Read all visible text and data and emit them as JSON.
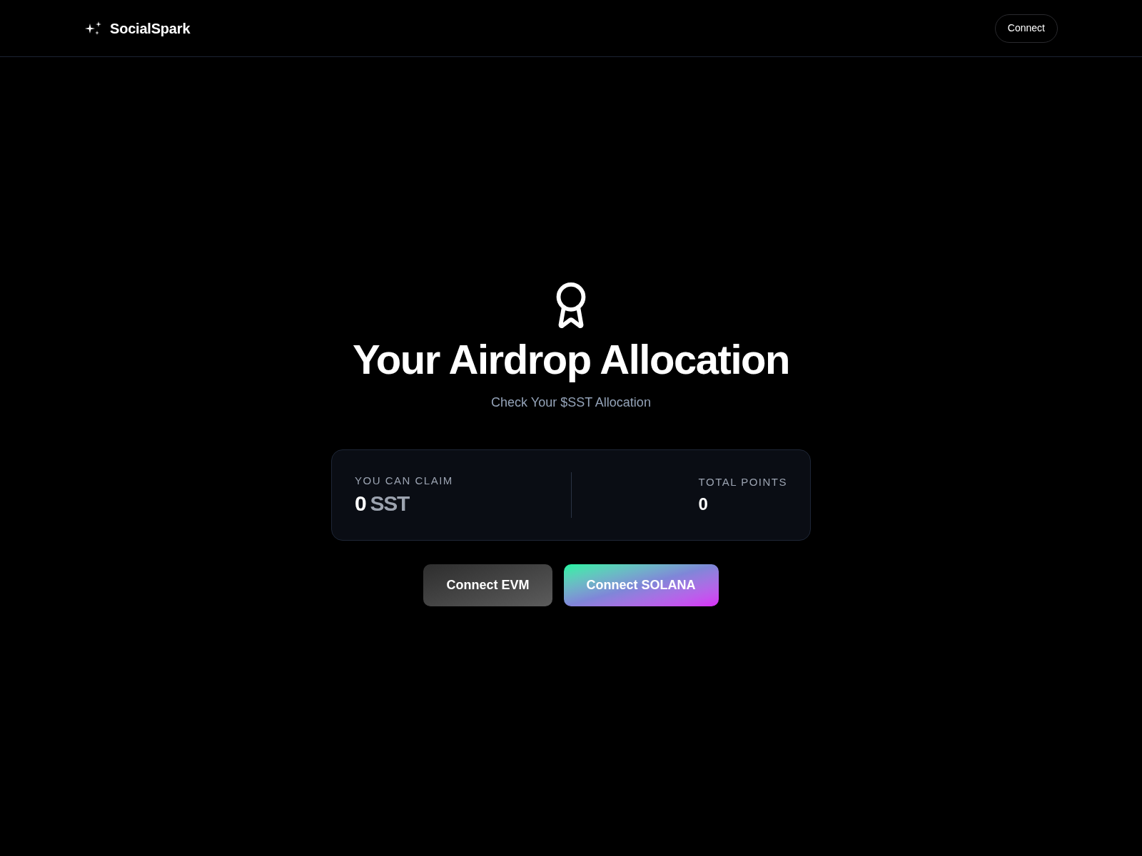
{
  "header": {
    "brand": "SocialSpark",
    "connect_button": "Connect"
  },
  "hero": {
    "title": "Your Airdrop Allocation",
    "subtitle": "Check Your $SST Allocation"
  },
  "stats": {
    "claim": {
      "label": "YOU CAN CLAIM",
      "amount": "0",
      "unit": "SST"
    },
    "points": {
      "label": "TOTAL POINTS",
      "value": "0"
    }
  },
  "actions": [
    {
      "label": "Connect EVM",
      "kind": "evm"
    },
    {
      "label": "Connect SOLANA",
      "kind": "solana"
    }
  ]
}
